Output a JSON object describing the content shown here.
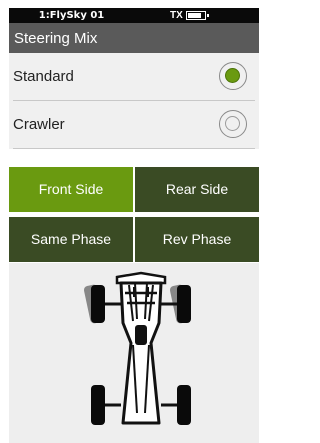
{
  "status": {
    "model_name": "1:FlySky 01",
    "tx_label": "TX",
    "battery_level": 0.8
  },
  "screen": {
    "title": "Steering Mix"
  },
  "mix_options": [
    {
      "label": "Standard",
      "selected": true
    },
    {
      "label": "Crawler",
      "selected": false
    }
  ],
  "steer_tabs": {
    "front": "Front Side",
    "rear": "Rear Side",
    "same": "Same Phase",
    "rev": "Rev Phase",
    "active": "front"
  },
  "colors": {
    "accent": "#6a9a10",
    "inactive_tab": "#3a4b24",
    "title_bg": "#5a5a5a"
  },
  "icons": {
    "vehicle": "crawler-car-topview-icon"
  }
}
